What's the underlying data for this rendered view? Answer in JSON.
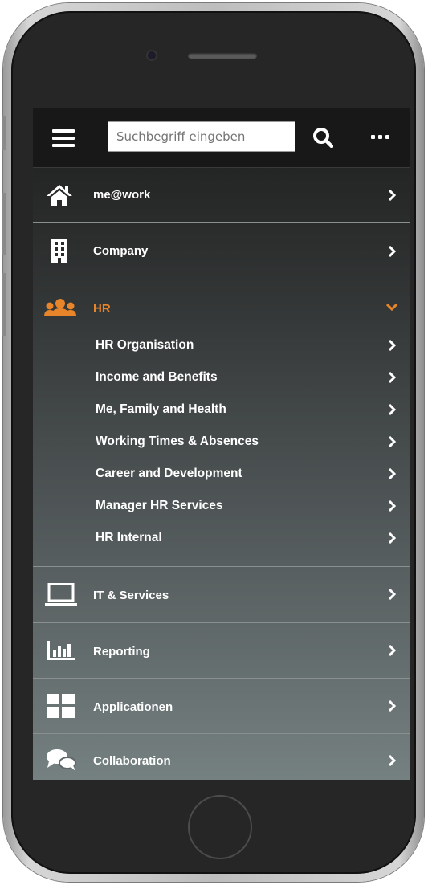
{
  "search": {
    "placeholder": "Suchbegriff eingeben",
    "value": ""
  },
  "menu": {
    "items": [
      {
        "label": "me@work",
        "icon": "home-icon"
      },
      {
        "label": "Company",
        "icon": "building-icon"
      },
      {
        "label": "HR",
        "icon": "users-icon",
        "expanded": true,
        "color": "#e8852a"
      },
      {
        "label": "IT & Services",
        "icon": "laptop-icon"
      },
      {
        "label": "Reporting",
        "icon": "bar-chart-icon"
      },
      {
        "label": "Applicationen",
        "icon": "grid-icon"
      },
      {
        "label": "Collaboration",
        "icon": "chat-icon"
      }
    ],
    "hr_subitems": [
      "HR Organisation",
      "Income and Benefits",
      "Me, Family and Health",
      "Working Times & Absences",
      "Career and Development",
      "Manager HR Services",
      "HR Internal"
    ]
  },
  "colors": {
    "accent": "#e8852a",
    "topbar": "#181818",
    "text": "#ffffff"
  }
}
